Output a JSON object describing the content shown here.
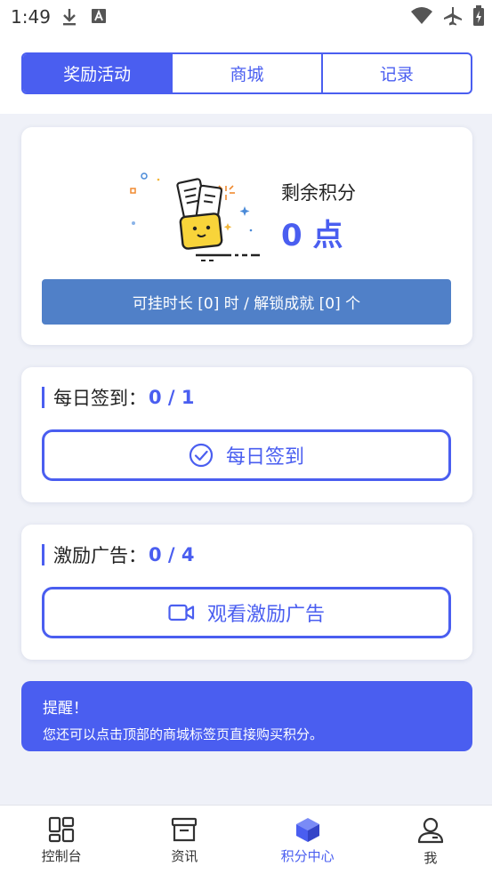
{
  "status_bar": {
    "time": "1:49",
    "left_icons": [
      "download-icon",
      "font-icon"
    ],
    "right_icons": [
      "wifi-icon",
      "airplane-icon",
      "battery-icon"
    ]
  },
  "tabs": [
    {
      "label": "奖励活动",
      "active": true
    },
    {
      "label": "商城",
      "active": false
    },
    {
      "label": "记录",
      "active": false
    }
  ],
  "points_card": {
    "label": "剩余积分",
    "value": "0 点",
    "info": "可挂时长 [0] 时 / 解锁成就 [0] 个"
  },
  "daily_checkin": {
    "title": "每日签到：",
    "count": "0 / 1",
    "button_label": "每日签到",
    "button_icon": "check-circle-icon"
  },
  "ad_reward": {
    "title": "激励广告：",
    "count": "0 / 4",
    "button_label": "观看激励广告",
    "button_icon": "video-icon"
  },
  "notice": {
    "title": "提醒！",
    "body": "您还可以点击顶部的商城标签页直接购买积分。"
  },
  "bottom_nav": [
    {
      "label": "控制台",
      "icon": "dashboard-icon",
      "active": false
    },
    {
      "label": "资讯",
      "icon": "news-icon",
      "active": false
    },
    {
      "label": "积分中心",
      "icon": "cube-icon",
      "active": true
    },
    {
      "label": "我",
      "icon": "user-icon",
      "active": false
    }
  ],
  "colors": {
    "accent": "#4a5ef0",
    "info_bar": "#5080c8",
    "background": "#eff1f8"
  }
}
